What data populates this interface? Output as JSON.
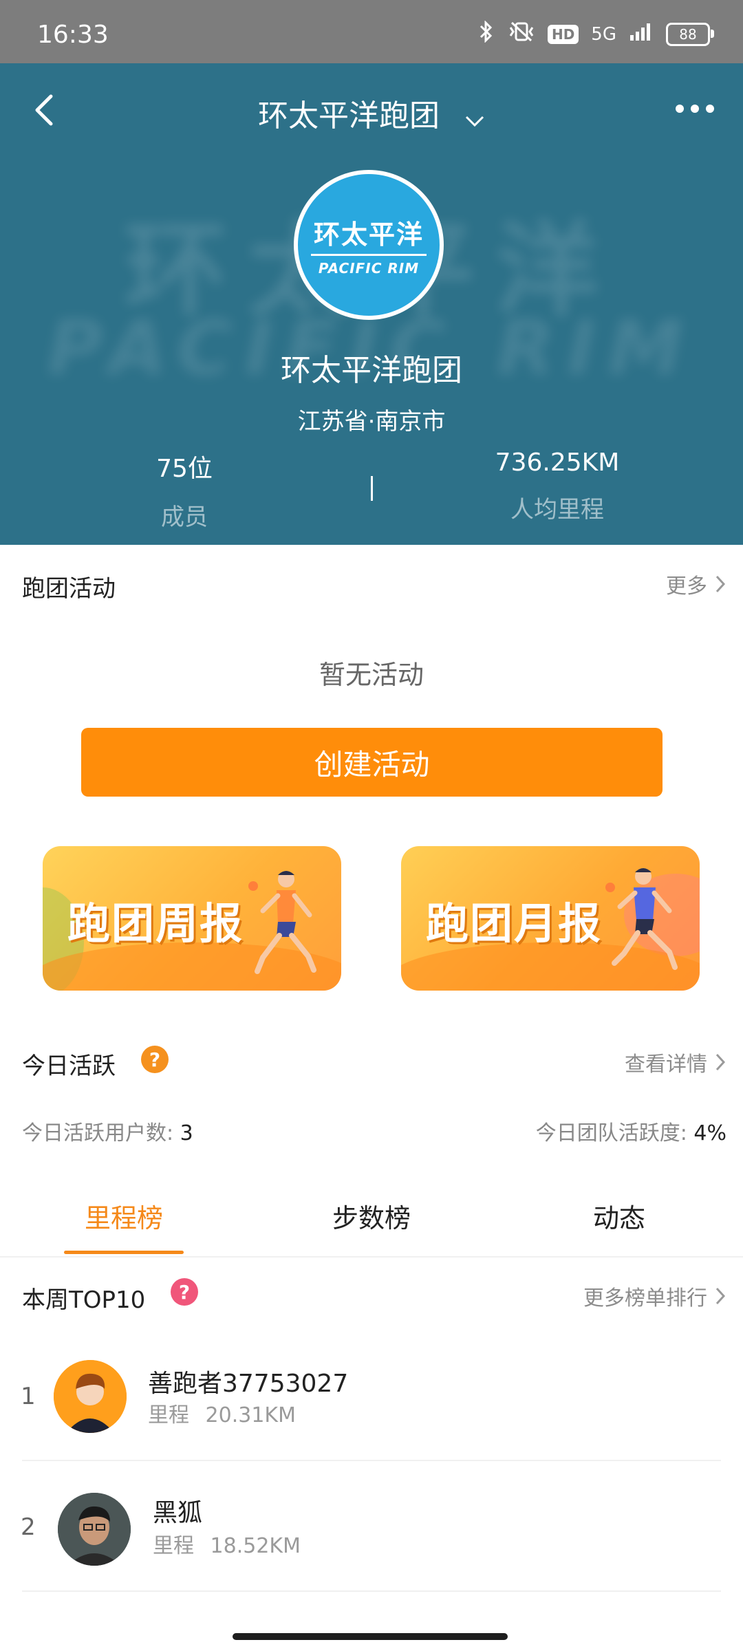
{
  "status_bar": {
    "time": "16:33",
    "network": "5G",
    "hd": "HD",
    "battery": "88"
  },
  "header": {
    "title": "环太平洋跑团",
    "logo_cn": "环太平洋",
    "logo_en": "PACIFIC RIM",
    "club_name": "环太平洋跑团",
    "location": "江苏省·南京市",
    "members_value": "75位",
    "members_label": "成员",
    "avg_distance_value": "736.25KM",
    "avg_distance_label": "人均里程",
    "bg_color": "#2d7189"
  },
  "activities": {
    "title": "跑团活动",
    "more": "更多",
    "empty": "暂无活动",
    "create_button": "创建活动",
    "accent": "#ff8d0a"
  },
  "banners": {
    "weekly": "跑团周报",
    "monthly": "跑团月报"
  },
  "today_active": {
    "title": "今日活跃",
    "detail_link": "查看详情",
    "users_label": "今日活跃用户数:",
    "users_value": "3",
    "rate_label": "今日团队活跃度:",
    "rate_value": "4%"
  },
  "tabs": [
    {
      "label": "里程榜",
      "active": true
    },
    {
      "label": "步数榜",
      "active": false
    },
    {
      "label": "动态",
      "active": false
    }
  ],
  "leaderboard": {
    "title": "本周TOP10",
    "more": "更多榜单排行",
    "distance_label": "里程",
    "entries": [
      {
        "rank": "1",
        "name": "善跑者37753027",
        "distance": "20.31KM"
      },
      {
        "rank": "2",
        "name": "黑狐",
        "distance": "18.52KM"
      }
    ]
  }
}
